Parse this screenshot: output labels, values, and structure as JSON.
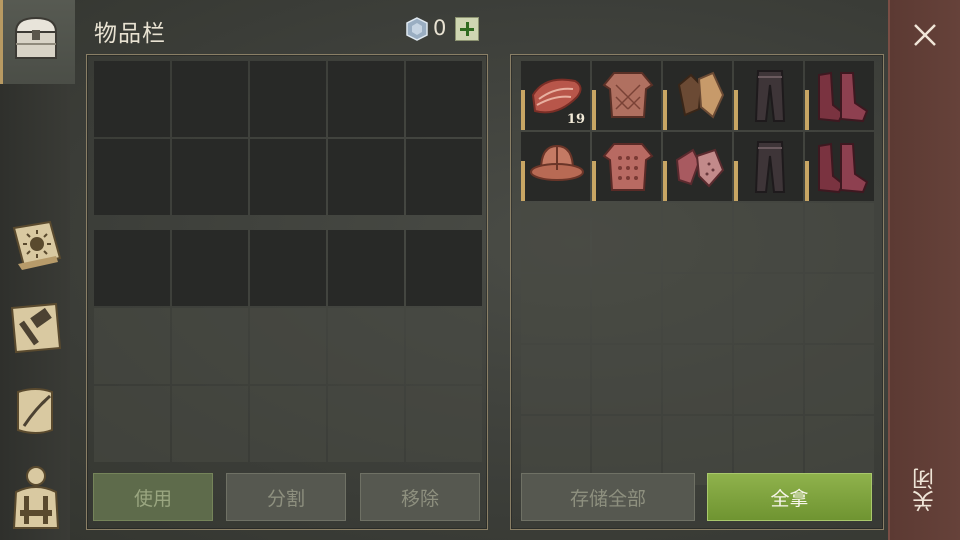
{
  "header": {
    "title": "物品栏",
    "currency_count": "0"
  },
  "colors": {
    "accent_gold": "#c8a664",
    "button_green": "#7fa23e",
    "close_strip": "#62403a"
  },
  "sidebar": {
    "items": [
      {
        "icon": "chest-icon",
        "selected": true
      },
      {
        "icon": "sun-book-icon"
      },
      {
        "icon": "crafting-hammer-icon"
      },
      {
        "icon": "scroll-quill-icon"
      },
      {
        "icon": "character-equipment-icon"
      }
    ]
  },
  "inventory": {
    "top_rows": 2,
    "top_cols": 5,
    "bottom_rows": 3,
    "bottom_cols": 5,
    "bottom_dark_rows": 1
  },
  "loot": {
    "rows": 6,
    "cols": 5,
    "items": [
      {
        "name": "raw-meat",
        "count": "19"
      },
      {
        "name": "quilted-armor"
      },
      {
        "name": "leather-gloves"
      },
      {
        "name": "leather-pants"
      },
      {
        "name": "leather-boots"
      },
      {
        "name": "kettle-helmet"
      },
      {
        "name": "chainmail-armor"
      },
      {
        "name": "chainmail-gloves"
      },
      {
        "name": "leather-pants"
      },
      {
        "name": "leather-boots"
      }
    ]
  },
  "buttons": {
    "use": "使用",
    "split": "分割",
    "remove": "移除",
    "store_all": "存储全部",
    "take_all": "全拿"
  },
  "close": {
    "label": "关闭"
  }
}
